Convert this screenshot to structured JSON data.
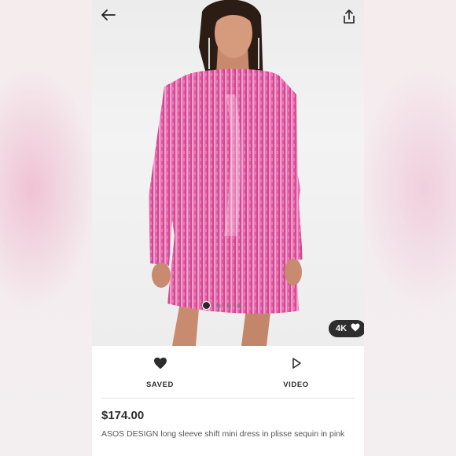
{
  "product": {
    "price": "$174.00",
    "title": "ASOS DESIGN long sleeve shift mini dress in plisse sequin in pink"
  },
  "gallery": {
    "image_count": 4,
    "active_index": 0,
    "badge_label": "4K"
  },
  "actions": [
    {
      "label": "SAVED",
      "icon": "heart-filled-icon"
    },
    {
      "label": "VIDEO",
      "icon": "play-icon"
    }
  ],
  "header": {
    "back_icon": "back-arrow-icon",
    "share_icon": "share-icon"
  },
  "colors": {
    "dress_pink": "#e0549f",
    "dark": "#2d2d2d"
  }
}
